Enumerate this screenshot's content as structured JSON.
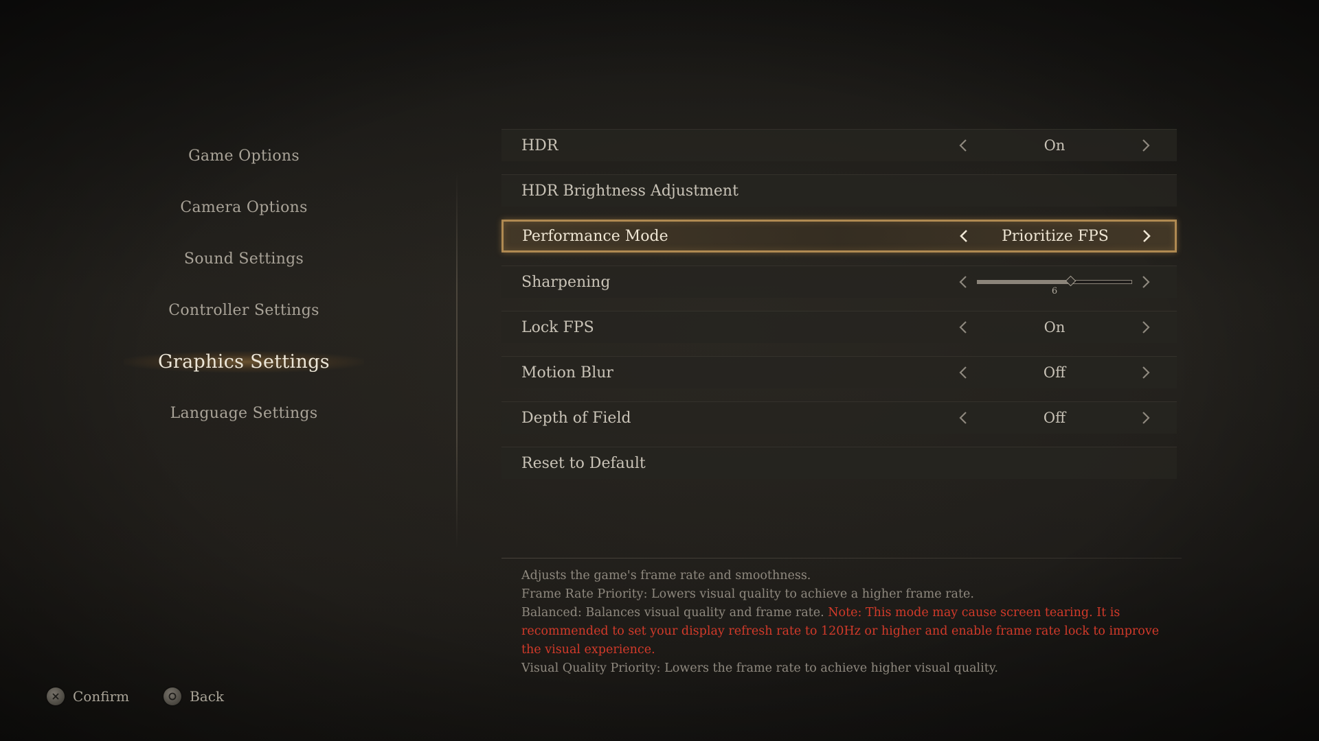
{
  "menu": {
    "items": [
      {
        "label": "Game Options",
        "active": false
      },
      {
        "label": "Camera Options",
        "active": false
      },
      {
        "label": "Sound Settings",
        "active": false
      },
      {
        "label": "Controller Settings",
        "active": false
      },
      {
        "label": "Graphics Settings",
        "active": true
      },
      {
        "label": "Language Settings",
        "active": false
      }
    ]
  },
  "settings": {
    "hdr": {
      "label": "HDR",
      "value": "On"
    },
    "hdr_brightness": {
      "label": "HDR Brightness Adjustment"
    },
    "performance_mode": {
      "label": "Performance Mode",
      "value": "Prioritize FPS"
    },
    "sharpening": {
      "label": "Sharpening",
      "value": "6",
      "level_fraction": 0.6
    },
    "lock_fps": {
      "label": "Lock FPS",
      "value": "On"
    },
    "motion_blur": {
      "label": "Motion Blur",
      "value": "Off"
    },
    "depth_of_field": {
      "label": "Depth of Field",
      "value": "Off"
    },
    "reset": {
      "label": "Reset to Default"
    }
  },
  "description": {
    "line1": "Adjusts the game's frame rate and smoothness.",
    "line2": "Frame Rate Priority: Lowers visual quality to achieve a higher frame rate.",
    "line3_prefix": "Balanced: Balances visual quality and frame rate.",
    "line3_warning": "Note: This mode may cause screen tearing. It is recommended to set your display refresh rate to 120Hz or higher and enable frame rate lock to improve the visual experience.",
    "line4": "Visual Quality Priority: Lowers the frame rate to achieve higher visual quality."
  },
  "footer": {
    "confirm_label": "Confirm",
    "back_label": "Back",
    "confirm_icon": "cross-button-icon",
    "back_icon": "circle-button-icon"
  },
  "colors": {
    "accent": "#b08a52",
    "warning": "#d23a2a"
  }
}
